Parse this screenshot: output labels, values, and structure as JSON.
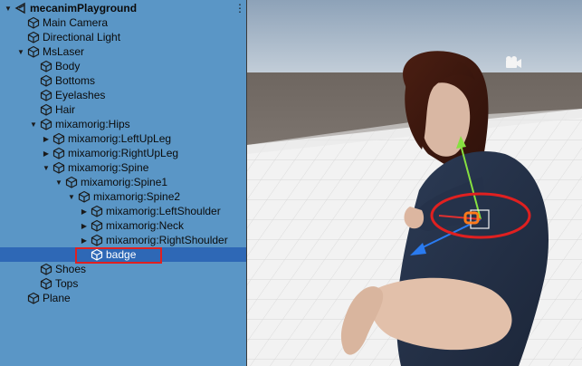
{
  "hierarchy": {
    "scene_name": "mecanimPlayground",
    "items": [
      {
        "label": "Main Camera",
        "depth": 1,
        "arrow": "none"
      },
      {
        "label": "Directional Light",
        "depth": 1,
        "arrow": "none"
      },
      {
        "label": "MsLaser",
        "depth": 1,
        "arrow": "expanded"
      },
      {
        "label": "Body",
        "depth": 2,
        "arrow": "none"
      },
      {
        "label": "Bottoms",
        "depth": 2,
        "arrow": "none"
      },
      {
        "label": "Eyelashes",
        "depth": 2,
        "arrow": "none"
      },
      {
        "label": "Hair",
        "depth": 2,
        "arrow": "none"
      },
      {
        "label": "mixamorig:Hips",
        "depth": 2,
        "arrow": "expanded"
      },
      {
        "label": "mixamorig:LeftUpLeg",
        "depth": 3,
        "arrow": "collapsed"
      },
      {
        "label": "mixamorig:RightUpLeg",
        "depth": 3,
        "arrow": "collapsed"
      },
      {
        "label": "mixamorig:Spine",
        "depth": 3,
        "arrow": "expanded"
      },
      {
        "label": "mixamorig:Spine1",
        "depth": 4,
        "arrow": "expanded"
      },
      {
        "label": "mixamorig:Spine2",
        "depth": 5,
        "arrow": "expanded"
      },
      {
        "label": "mixamorig:LeftShoulder",
        "depth": 6,
        "arrow": "collapsed"
      },
      {
        "label": "mixamorig:Neck",
        "depth": 6,
        "arrow": "collapsed"
      },
      {
        "label": "mixamorig:RightShoulder",
        "depth": 6,
        "arrow": "collapsed"
      },
      {
        "label": "badge",
        "depth": 6,
        "arrow": "none",
        "selected": true
      },
      {
        "label": "Shoes",
        "depth": 2,
        "arrow": "none"
      },
      {
        "label": "Tops",
        "depth": 2,
        "arrow": "none"
      },
      {
        "label": "Plane",
        "depth": 1,
        "arrow": "none"
      }
    ]
  },
  "icons": {
    "scene": "unity-scene-icon",
    "gameobject": "cube-icon",
    "menu": "kebab-menu-icon",
    "camera_gizmo": "camera-gizmo-icon"
  },
  "colors": {
    "panel_bg": "#5a96c6",
    "selected_bg": "#2e68b6",
    "annotation_red": "#e02020",
    "gizmo_y": "#86e040",
    "gizmo_z": "#2a7bf0",
    "badge_orange": "#ff7a1a"
  }
}
